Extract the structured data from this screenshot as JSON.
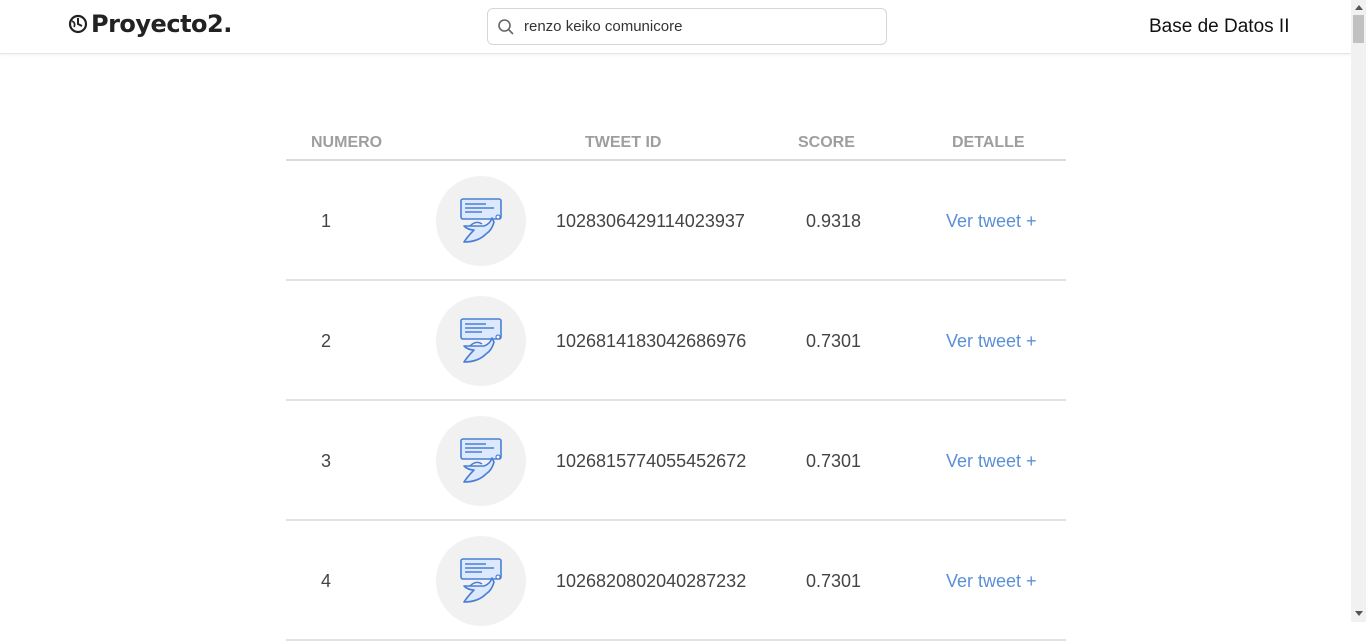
{
  "navbar": {
    "brand": "Proyecto2.",
    "brand_icon": "globe-clock-icon",
    "search": {
      "value": "renzo keiko comunicore",
      "placeholder": ""
    },
    "right_label": "Base de Datos II"
  },
  "table": {
    "headers": {
      "numero": "NUMERO",
      "tweet_id": "TWEET ID",
      "score": "SCORE",
      "detalle": "DETALLE"
    },
    "rows": [
      {
        "numero": "1",
        "tweet_id": "1028306429114023937",
        "score": "0.9318",
        "link": "Ver tweet +"
      },
      {
        "numero": "2",
        "tweet_id": "1026814183042686976",
        "score": "0.7301",
        "link": "Ver tweet +"
      },
      {
        "numero": "3",
        "tweet_id": "1026815774055452672",
        "score": "0.7301",
        "link": "Ver tweet +"
      },
      {
        "numero": "4",
        "tweet_id": "1026820802040287232",
        "score": "0.7301",
        "link": "Ver tweet +"
      }
    ]
  },
  "colors": {
    "accent": "#5b8fd9",
    "icon_blue": "#4a7fd6",
    "avatar_bg": "#f1f1f1"
  }
}
